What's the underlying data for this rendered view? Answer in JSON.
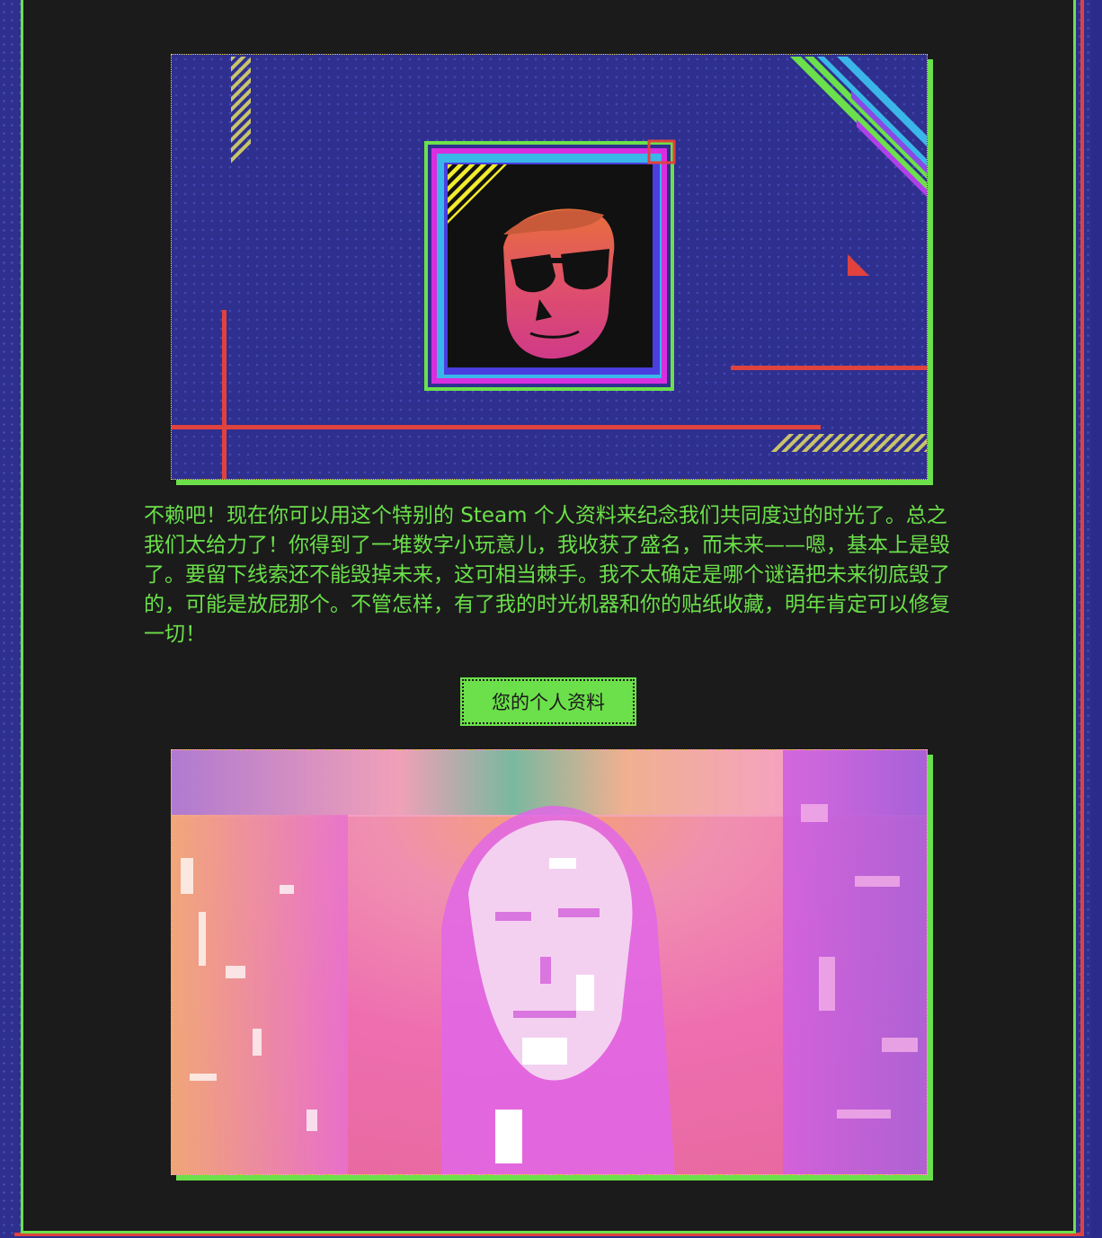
{
  "description": "不赖吧！现在你可以用这个特别的 Steam 个人资料来纪念我们共同度过的时光了。总之我们太给力了！你得到了一堆数字小玩意儿，我收获了盛名，而未来——嗯，基本上是毁了。要留下线索还不能毁掉未来，这可相当棘手。我不太确定是哪个谜语把未来彻底毁了的，可能是放屁那个。不管怎样，有了我的时光机器和你的贴纸收藏，明年肯定可以修复一切！",
  "cta": {
    "label": "您的个人资料"
  },
  "colors": {
    "panel_bg": "#1b1b1b",
    "accent_green": "#6be04a",
    "accent_red": "#e0423e",
    "indigo": "#2e2f8f",
    "magenta": "#d92ee0",
    "cyan": "#3ab7e8",
    "yellow": "#f2ec2e"
  },
  "images": {
    "hero": "avatar-frame-illustration",
    "banner": "glitch-portrait-background"
  }
}
